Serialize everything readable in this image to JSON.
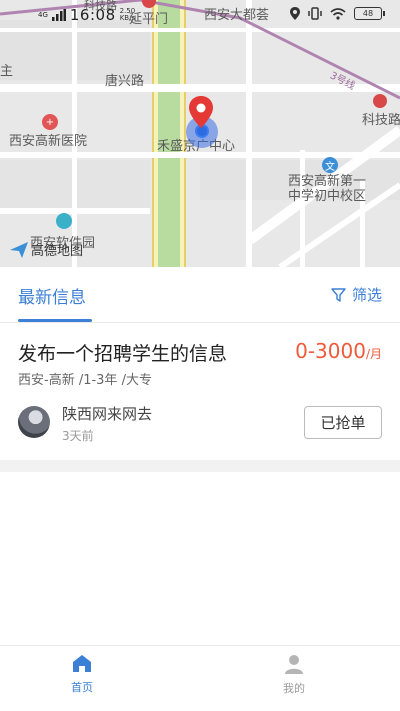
{
  "status_bar": {
    "network": "4G",
    "time": "16:08",
    "speed_value": "2.50",
    "speed_unit": "KB/s",
    "battery": "48"
  },
  "map": {
    "labels": {
      "top_road": "科技路",
      "yanpingmen": "延平门",
      "xian_dadu": "西安大都荟",
      "tangxing_road": "唐兴路",
      "hospital": "西安高新医院",
      "hesheng": "禾盛京广中心",
      "keji_station": "科技路",
      "school": "西安高新第一\n中学初中校区",
      "software_park": "西安软件园",
      "line3": "3号线",
      "left_edge": "主"
    },
    "logo_text": "高德地图"
  },
  "tabs": {
    "latest": "最新信息",
    "filter": "筛选"
  },
  "job": {
    "title": "发布一个招聘学生的信息",
    "salary": "0-3000",
    "salary_unit": "/月",
    "meta": "西安-高新 /1-3年 /大专",
    "company": "陕西网来网去",
    "time_ago": "3天前",
    "action": "已抢单"
  },
  "bottom_nav": {
    "home": "首页",
    "mine": "我的"
  },
  "colors": {
    "accent": "#3b7fd6",
    "salary": "#ee5a3a"
  }
}
